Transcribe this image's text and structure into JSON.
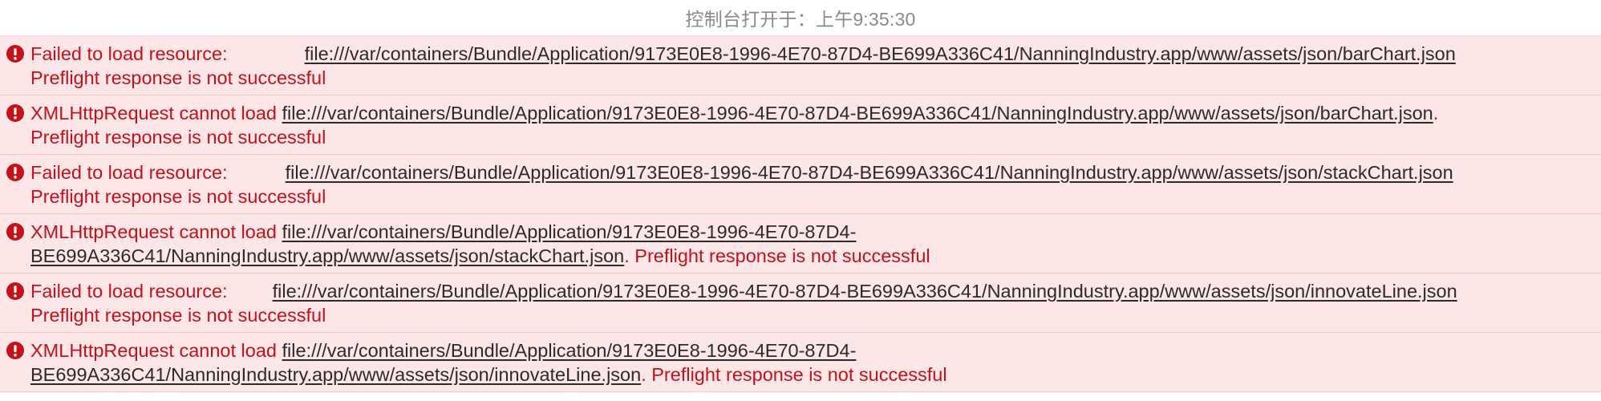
{
  "header": {
    "title": "控制台打开于：上午9:35:30"
  },
  "colors": {
    "error_text": "#c4111a",
    "error_bg": "#fde6e7",
    "link_text": "#2b2b2b",
    "header_text": "#8a8a8a"
  },
  "entries": [
    {
      "icon": "error-icon",
      "prefix": "Failed to load resource:",
      "url": "file:///var/containers/Bundle/Application/9173E0E8-1996-4E70-87D4-BE699A336C41/NanningIndustry.app/www/assets/json/barChart.json",
      "punct": "",
      "detail": "Preflight response is not successful"
    },
    {
      "icon": "error-icon",
      "prefix": "XMLHttpRequest cannot load",
      "url": "file:///var/containers/Bundle/Application/9173E0E8-1996-4E70-87D4-BE699A336C41/NanningIndustry.app/www/assets/json/barChart.json",
      "punct": ".",
      "detail": "Preflight response is not successful"
    },
    {
      "icon": "error-icon",
      "prefix": "Failed to load resource:",
      "url": "file:///var/containers/Bundle/Application/9173E0E8-1996-4E70-87D4-BE699A336C41/NanningIndustry.app/www/assets/json/stackChart.json",
      "punct": "",
      "detail": "Preflight response is not successful"
    },
    {
      "icon": "error-icon",
      "prefix": "XMLHttpRequest cannot load",
      "url_line1": "file:///var/containers/Bundle/Application/9173E0E8-1996-4E70-87D4-",
      "url_line2": "BE699A336C41/NanningIndustry.app/www/assets/json/stackChart.json",
      "punct": ".",
      "detail": "Preflight response is not successful"
    },
    {
      "icon": "error-icon",
      "prefix": "Failed to load resource:",
      "url": "file:///var/containers/Bundle/Application/9173E0E8-1996-4E70-87D4-BE699A336C41/NanningIndustry.app/www/assets/json/innovateLine.json",
      "punct": "",
      "detail": "Preflight response is not successful"
    },
    {
      "icon": "error-icon",
      "prefix": "XMLHttpRequest cannot load",
      "url_line1": "file:///var/containers/Bundle/Application/9173E0E8-1996-4E70-87D4-",
      "url_line2": "BE699A336C41/NanningIndustry.app/www/assets/json/innovateLine.json",
      "punct": ".",
      "detail": "Preflight response is not successful"
    }
  ]
}
